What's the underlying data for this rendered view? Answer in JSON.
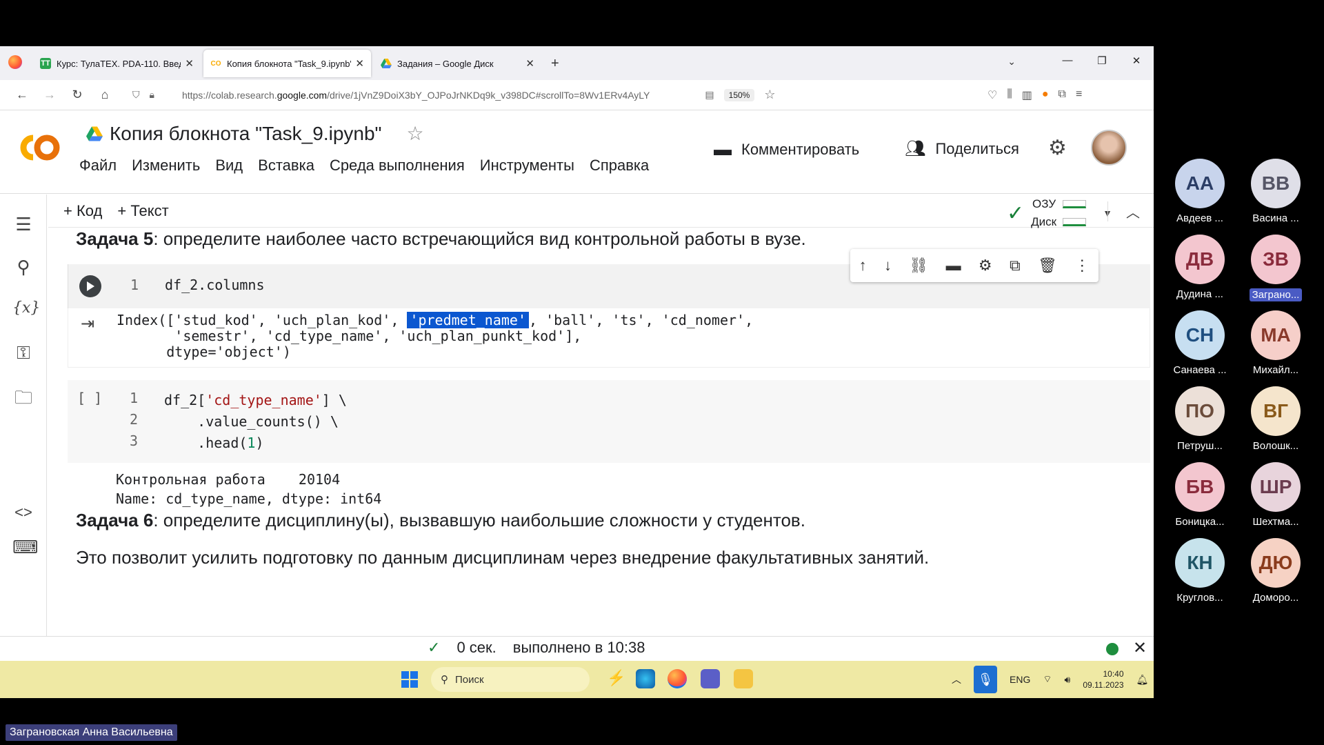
{
  "browser": {
    "tabs": [
      {
        "label": "Курс: ТулаТЕХ. PDA-110. Введе",
        "favicon": "ТТ",
        "active": false
      },
      {
        "label": "Копия блокнота \"Task_9.ipynb\"",
        "favicon": "CO",
        "active": true
      },
      {
        "label": "Задания – Google Диск",
        "favicon": "drive",
        "active": false
      }
    ],
    "url_prefix": "https://colab.research.",
    "url_domain": "google.com",
    "url_rest": "/drive/1jVnZ9DoiX3bY_OJPoJrNKDq9k_v398DC#scrollTo=8Wv1ERv4AyLY",
    "zoom": "150%"
  },
  "colab": {
    "title": "Копия блокнота \"Task_9.ipynb\"",
    "menu": [
      "Файл",
      "Изменить",
      "Вид",
      "Вставка",
      "Среда выполнения",
      "Инструменты",
      "Справка"
    ],
    "comment_label": "Комментировать",
    "share_label": "Поделиться",
    "add_code": "+ Код",
    "add_text": "+ Текст",
    "ram_label": "ОЗУ",
    "disk_label": "Диск"
  },
  "notebook": {
    "task5_bold": "Задача 5",
    "task5_text": ": определите наиболее часто встречающийся вид контрольной работы в вузе.",
    "cell1": {
      "line_no": "1",
      "code": "df_2.columns",
      "out_l1_a": "Index(['stud_kod', 'uch_plan_kod', ",
      "out_l1_hl": "'predmet_name'",
      "out_l1_b": ", 'ball', 'ts', 'cd_nomer',",
      "out_l2": "       'semestr', 'cd_type_name', 'uch_plan_punkt_kod'],",
      "out_l3": "      dtype='object')"
    },
    "cell2": {
      "exec_count": "[ ]",
      "line_nos": [
        "1",
        "2",
        "3"
      ],
      "l1_a": "df_2[",
      "l1_str": "'cd_type_name'",
      "l1_b": "] \\",
      "l2": "    .value_counts() \\",
      "l3_a": "    .head(",
      "l3_num": "1",
      "l3_b": ")",
      "out_l1": "Контрольная работа    20104",
      "out_l2": "Name: cd_type_name, dtype: int64"
    },
    "task6_bold": "Задача 6",
    "task6_text": ": определите дисциплину(ы), вызвавшую наибольшие сложности у студентов.",
    "task6_sub": "Это позволит усилить подготовку по данным дисциплинам через внедрение факультативных занятий."
  },
  "status": {
    "time": "0 сек.",
    "done": "выполнено в 10:38"
  },
  "taskbar": {
    "search_placeholder": "Поиск",
    "lang": "ENG",
    "time": "10:40",
    "date": "09.11.2023"
  },
  "participants": [
    {
      "initials": "АА",
      "name": "Авдеев ...",
      "bg": "#c8d4ec",
      "fg": "#2c3e66"
    },
    {
      "initials": "ВВ",
      "name": "Васина ...",
      "bg": "#dfdfe8",
      "fg": "#555566"
    },
    {
      "initials": "ДВ",
      "name": "Дудина ...",
      "bg": "#f3c6cf",
      "fg": "#8a2b3c"
    },
    {
      "initials": "ЗВ",
      "name": "Заграно...",
      "bg": "#f3c6cf",
      "fg": "#8a2b3c",
      "selected": true
    },
    {
      "initials": "СН",
      "name": "Санаева ...",
      "bg": "#c7dff1",
      "fg": "#1f4f80"
    },
    {
      "initials": "МА",
      "name": "Михайл...",
      "bg": "#f6cfc9",
      "fg": "#8a3b2c"
    },
    {
      "initials": "ПО",
      "name": "Петруш...",
      "bg": "#ece0d8",
      "fg": "#6b4c3b"
    },
    {
      "initials": "ВГ",
      "name": "Волошк...",
      "bg": "#f5e5cc",
      "fg": "#8a5a1a"
    },
    {
      "initials": "БВ",
      "name": "Боницка...",
      "bg": "#f3c6cf",
      "fg": "#8a2b3c"
    },
    {
      "initials": "ШР",
      "name": "Шехтма...",
      "bg": "#e8d4dc",
      "fg": "#6b3c4f"
    },
    {
      "initials": "КН",
      "name": "Круглов...",
      "bg": "#c7e3ec",
      "fg": "#1f5566"
    },
    {
      "initials": "ДЮ",
      "name": "Доморо...",
      "bg": "#f6d2c4",
      "fg": "#8a3b1c"
    }
  ],
  "speaker_name": "Заграновская Анна Васильевна"
}
